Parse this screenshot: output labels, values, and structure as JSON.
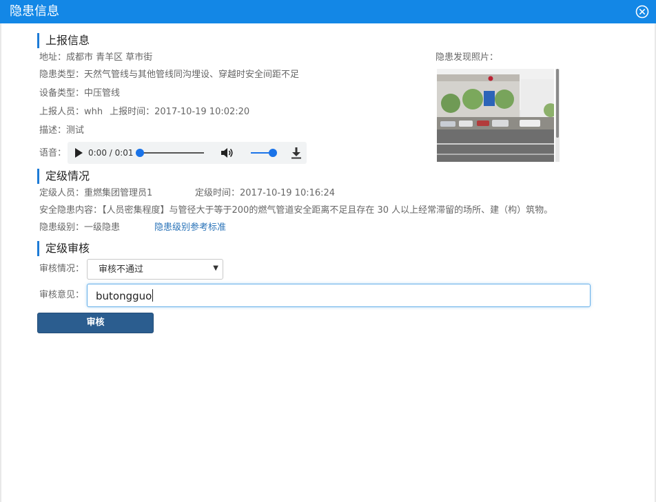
{
  "dialog": {
    "title": "隐患信息"
  },
  "report": {
    "section_title": "上报信息",
    "address": "地址：成都市 青羊区 草市街",
    "hazard_type": "隐患类型：天然气管线与其他管线同沟埋设、穿越时安全间距不足",
    "device_type": "设备类型：中压管线",
    "reporter": "上报人员：whh",
    "report_time": "上报时间：2017-10-19 10:02:20",
    "description": "描述：测试",
    "voice_label": "语音：",
    "photo_label": "隐患发现照片：",
    "audio": {
      "time": "0:00 / 0:01",
      "progress": 0,
      "volume": 1
    }
  },
  "grading": {
    "section_title": "定级情况",
    "grader": "定级人员：重燃集团管理员1",
    "grade_time": "定级时间：2017-10-19 10:16:24",
    "content": "安全隐患内容：【人员密集程度】与管径大于等于200的燃气管道安全距离不足且存在 30 人以上经常滞留的场所、建（构）筑物。",
    "level": "隐患级别：一级隐患",
    "level_link": "隐患级别参考标准"
  },
  "review": {
    "section_title": "定级审核",
    "status_label": "审核情况：",
    "status_value": "审核不通过",
    "opinion_label": "审核意见：",
    "opinion_value": "butongguo",
    "submit_label": "审核"
  },
  "colors": {
    "titlebar": "#1387e6",
    "accent": "#1d7bd6",
    "button": "#2b5d8f",
    "link": "#2a73b8"
  }
}
